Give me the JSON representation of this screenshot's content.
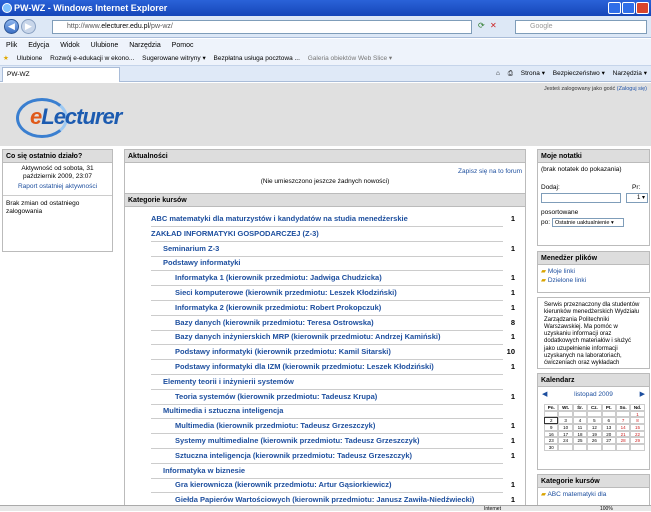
{
  "window": {
    "title": "PW-WZ - Windows Internet Explorer"
  },
  "address": {
    "url_prefix": "http://www.",
    "url_domain": "electurer.edu.pl",
    "url_path": "/pw-wz/",
    "search_placeholder": "Google"
  },
  "menu": [
    "Plik",
    "Edycja",
    "Widok",
    "Ulubione",
    "Narzędzia",
    "Pomoc"
  ],
  "favorites": {
    "label": "Ulubione",
    "items": [
      "Rozwój e-edukacji w ekono...",
      "Sugerowane witryny ▾",
      "Bezpłatna usługa pocztowa ...",
      "Galeria obiektów Web Slice ▾"
    ]
  },
  "tab": {
    "label": "PW-WZ"
  },
  "commands": [
    "Strona ▾",
    "Bezpieczeństwo ▾",
    "Narzędzia ▾"
  ],
  "header": {
    "login_text": "Jesteś zalogowany jako gość",
    "login_link": "(Zaloguj się)",
    "logo_e": "e",
    "logo_rest": "Lecturer"
  },
  "recent": {
    "title": "Co się ostatnio działo?",
    "activity": "Aktywność od sobota, 31 październik 2009, 23:07",
    "report_link": "Raport ostatniej aktywności",
    "no_changes": "Brak zmian od ostatniego zalogowania"
  },
  "news": {
    "title": "Aktualności",
    "subscribe": "Zapisz się na to forum",
    "empty": "(Nie umieszczono jeszcze żadnych nowości)"
  },
  "categories": {
    "title": "Kategorie kursów",
    "rows": [
      {
        "text": "ABC matematyki dla maturzystów i kandydatów na studia menedżerskie",
        "count": "1",
        "indent": 0
      },
      {
        "text": "ZAKŁAD INFORMATYKI GOSPODARCZEJ (Z-3)",
        "count": "",
        "indent": 0
      },
      {
        "text": "Seminarium Z-3",
        "count": "1",
        "indent": 1
      },
      {
        "text": "Podstawy informatyki",
        "count": "",
        "indent": 1
      },
      {
        "text": "Informatyka 1 (kierownik przedmiotu: Jadwiga Chudzicka)",
        "count": "1",
        "indent": 2
      },
      {
        "text": "Sieci komputerowe (kierownik przedmiotu: Leszek Kłodziński)",
        "count": "1",
        "indent": 2
      },
      {
        "text": "Informatyka 2 (kierownik przedmiotu: Robert Prokopczuk)",
        "count": "1",
        "indent": 2
      },
      {
        "text": "Bazy danych (kierownik przedmiotu: Teresa Ostrowska)",
        "count": "8",
        "indent": 2
      },
      {
        "text": "Bazy danych inżynierskich MRP (kierownik przedmiotu: Andrzej Kamiński)",
        "count": "1",
        "indent": 2
      },
      {
        "text": "Podstawy informatyki (kierownik przedmiotu: Kamil Sitarski)",
        "count": "10",
        "indent": 2
      },
      {
        "text": "Podstawy informatyki dla IZM (kierownik przedmiotu: Leszek Kłodziński)",
        "count": "1",
        "indent": 2
      },
      {
        "text": "Elementy teorii i inżynierii systemów",
        "count": "",
        "indent": 1
      },
      {
        "text": "Teoria systemów (kierownik przedmiotu: Tadeusz Krupa)",
        "count": "1",
        "indent": 2
      },
      {
        "text": "Multimedia i sztuczna inteligencja",
        "count": "",
        "indent": 1
      },
      {
        "text": "Multimedia (kierownik przedmiotu: Tadeusz Grzeszczyk)",
        "count": "1",
        "indent": 2
      },
      {
        "text": "Systemy multimedialne (kierownik przedmiotu: Tadeusz Grzeszczyk)",
        "count": "1",
        "indent": 2
      },
      {
        "text": "Sztuczna inteligencja (kierownik przedmiotu: Tadeusz Grzeszczyk)",
        "count": "1",
        "indent": 2
      },
      {
        "text": "Informatyka w biznesie",
        "count": "",
        "indent": 1
      },
      {
        "text": "Gra kierownicza (kierownik przedmiotu: Artur Gąsiorkiewicz)",
        "count": "1",
        "indent": 2
      },
      {
        "text": "Giełda Papierów Wartościowych (kierownik przedmiotu: Janusz Zawiła-Niedźwiecki)",
        "count": "1",
        "indent": 2
      }
    ]
  },
  "notes": {
    "title": "Moje notatki",
    "empty": "(brak notatek do pokazania)",
    "add_label": "Dodaj:",
    "pr_label": "Pr:",
    "pr_value": "1",
    "sort_label": "posortowane",
    "sort_by": "po:",
    "sort_value": "Ostatnie uaktualnienie"
  },
  "files": {
    "title": "Menedżer plików",
    "my_links": "Moje linki",
    "shared_links": "Dzielone linki"
  },
  "info": {
    "text": "Serwis przeznaczony dla studentów kierunków menedżerskich Wydziału Zarządzania Politechniki Warszawskiej. Ma pomóc w uzyskaniu informacji oraz dodatkowych materiałów i służyć jako uzupełnienie informacji uzyskanych na laboratoriach, ćwiczeniach oraz wykładach"
  },
  "calendar": {
    "title": "Kalendarz",
    "month": "listopad 2009",
    "days": [
      "Pn.",
      "Wt.",
      "Śr.",
      "Cz.",
      "Pt.",
      "So.",
      "Nd."
    ],
    "cells": [
      "",
      "",
      "",
      "",
      "",
      "",
      "1",
      "2",
      "3",
      "4",
      "5",
      "6",
      "7",
      "8",
      "9",
      "10",
      "11",
      "12",
      "13",
      "14",
      "15",
      "16",
      "17",
      "18",
      "19",
      "20",
      "21",
      "22",
      "23",
      "24",
      "25",
      "26",
      "27",
      "28",
      "29",
      "30",
      "",
      "",
      "",
      "",
      "",
      ""
    ]
  },
  "course_cats": {
    "title": "Kategorie kursów",
    "first": "ABC matematyki dla"
  },
  "status": {
    "zone": "Internet",
    "zoom": "100%"
  }
}
